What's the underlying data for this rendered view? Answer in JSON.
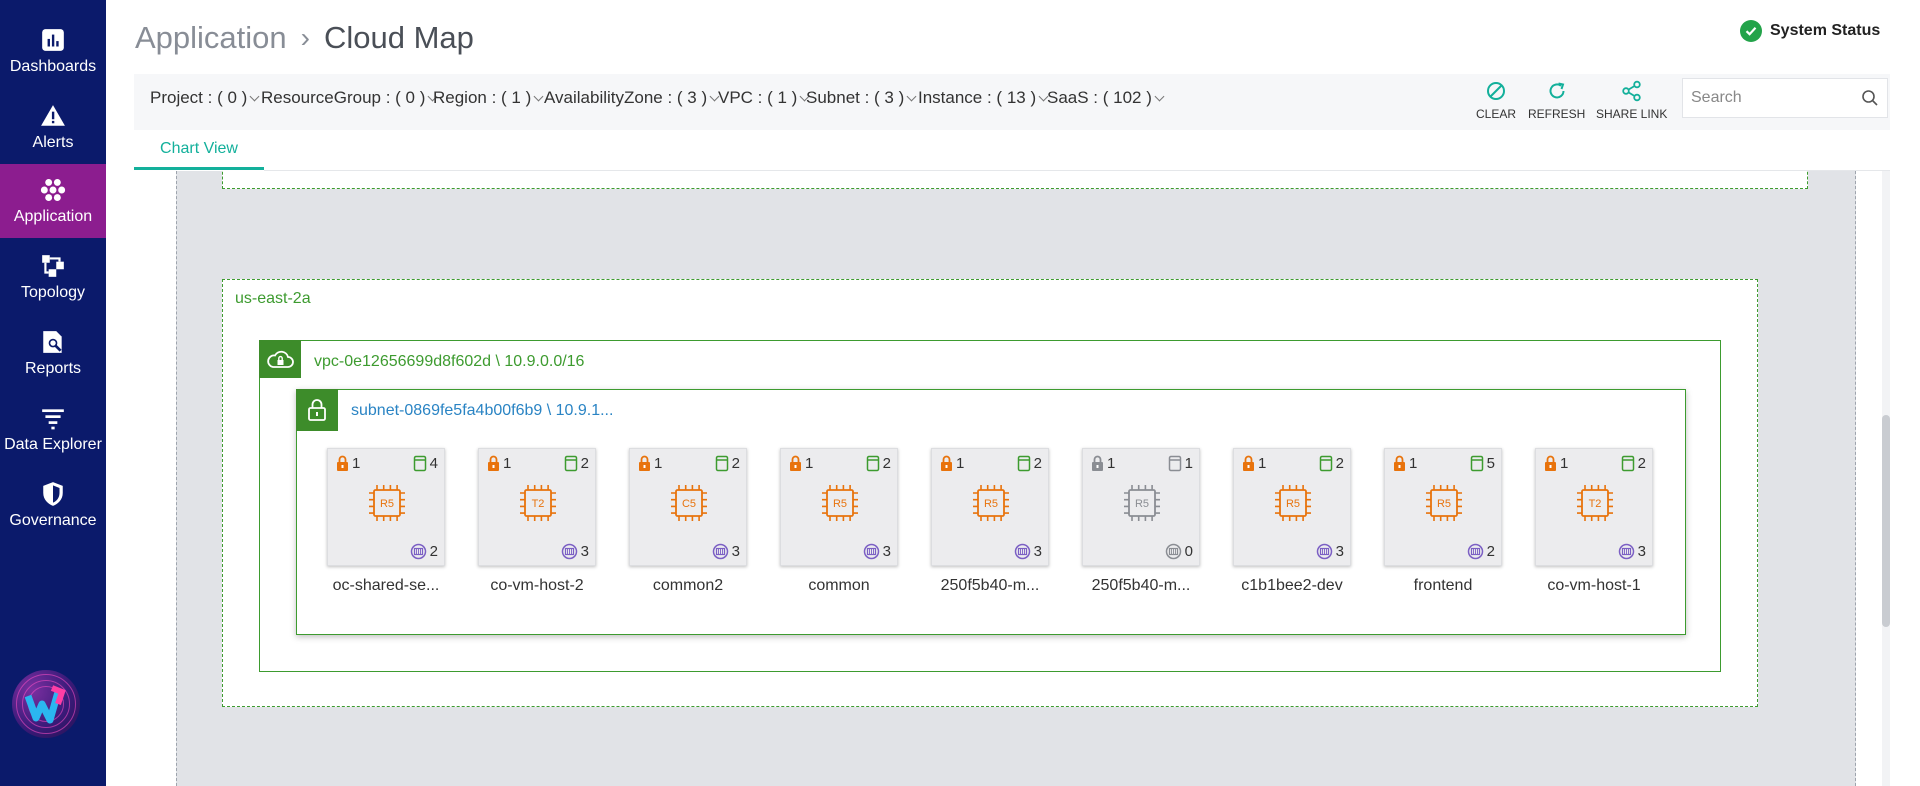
{
  "sidebar": {
    "items": [
      {
        "label": "Dashboards",
        "icon": "dashboard-icon",
        "active": false
      },
      {
        "label": "Alerts",
        "icon": "alert-icon",
        "active": false
      },
      {
        "label": "Application",
        "icon": "application-icon",
        "active": true
      },
      {
        "label": "Topology",
        "icon": "topology-icon",
        "active": false
      },
      {
        "label": "Reports",
        "icon": "reports-icon",
        "active": false
      },
      {
        "label": "Data Explorer",
        "icon": "data-explorer-icon",
        "active": false
      },
      {
        "label": "Governance",
        "icon": "governance-icon",
        "active": false
      }
    ],
    "active_color": "#8c1d8f",
    "background_color": "#0b1a6b"
  },
  "header": {
    "breadcrumb_parent": "Application",
    "breadcrumb_separator": "›",
    "breadcrumb_current": "Cloud Map",
    "system_status": "System Status",
    "status_color": "#23a34a"
  },
  "filters": [
    {
      "label": "Project : ( 0 )"
    },
    {
      "label": "ResourceGroup : ( 0 )"
    },
    {
      "label": "Region : ( 1 )"
    },
    {
      "label": "AvailabilityZone : ( 3 )"
    },
    {
      "label": "VPC : ( 1 )"
    },
    {
      "label": "Subnet : ( 3 )"
    },
    {
      "label": "Instance : ( 13 )"
    },
    {
      "label": "SaaS : ( 102 )"
    }
  ],
  "tools": {
    "clear": "CLEAR",
    "refresh": "REFRESH",
    "share": "SHARE LINK",
    "tool_color": "#13b09b"
  },
  "search": {
    "placeholder": "Search",
    "value": ""
  },
  "tabs": [
    {
      "label": "Chart View",
      "active": true
    }
  ],
  "map": {
    "zone_top_stub": "...",
    "availability_zone": "us-east-2a",
    "vpc_label": "vpc-0e12656699d8f602d \\ 10.9.0.0/16",
    "subnet_label": "subnet-0869fe5fa4b00f6b9 \\ 10.9.1...",
    "zone_color": "#3d9b2f",
    "subnet_label_color": "#2a84c4",
    "instances": [
      {
        "name": "oc-shared-se...",
        "type": "R5",
        "locks": "1",
        "disks": "4",
        "nets": "2",
        "active": true
      },
      {
        "name": "co-vm-host-2",
        "type": "T2",
        "locks": "1",
        "disks": "2",
        "nets": "3",
        "active": true
      },
      {
        "name": "common2",
        "type": "C5",
        "locks": "1",
        "disks": "2",
        "nets": "3",
        "active": true
      },
      {
        "name": "common",
        "type": "R5",
        "locks": "1",
        "disks": "2",
        "nets": "3",
        "active": true
      },
      {
        "name": "250f5b40-m...",
        "type": "R5",
        "locks": "1",
        "disks": "2",
        "nets": "3",
        "active": true
      },
      {
        "name": "250f5b40-m...",
        "type": "R5",
        "locks": "1",
        "disks": "1",
        "nets": "0",
        "active": false
      },
      {
        "name": "c1b1bee2-dev",
        "type": "R5",
        "locks": "1",
        "disks": "2",
        "nets": "3",
        "active": true
      },
      {
        "name": "frontend",
        "type": "R5",
        "locks": "1",
        "disks": "5",
        "nets": "2",
        "active": true
      },
      {
        "name": "co-vm-host-1",
        "type": "T2",
        "locks": "1",
        "disks": "2",
        "nets": "3",
        "active": true
      }
    ],
    "active_chip_color": "#e8730c",
    "inactive_chip_color": "#8a8d93",
    "disk_color": "#3d9b2f",
    "net_color": "#7b5fc4"
  }
}
